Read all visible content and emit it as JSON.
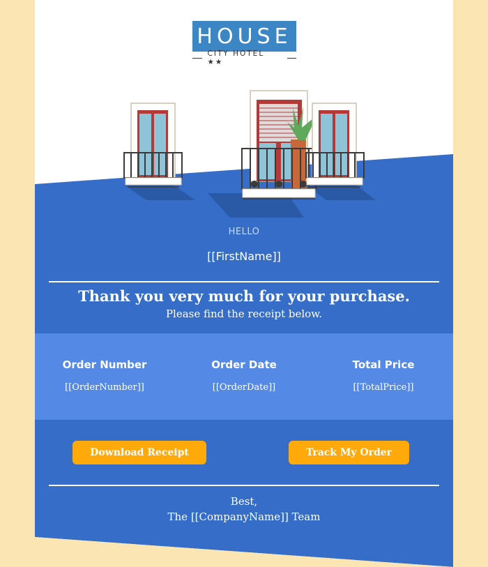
{
  "brand": {
    "name": "HOUSE",
    "tagline": "CITY HOTEL ★★"
  },
  "greeting": {
    "hello": "HELLO",
    "first_name": "[[FirstName]]"
  },
  "message": {
    "thanks": "Thank you very much for your purchase.",
    "subtitle": "Please find the receipt below."
  },
  "order": [
    {
      "label": "Order Number",
      "value": "[[OrderNumber]]"
    },
    {
      "label": "Order Date",
      "value": "[[OrderDate]]"
    },
    {
      "label": "Total Price",
      "value": "[[TotalPrice]]"
    }
  ],
  "actions": {
    "download": "Download Receipt",
    "track": "Track My Order"
  },
  "signoff": {
    "best": "Best,",
    "team": "The [[CompanyName]] Team"
  },
  "colors": {
    "page_bg": "#fbe5b3",
    "primary_blue": "#356dc9",
    "details_blue": "#548ae6",
    "button_orange": "#ffa90a",
    "logo_blue": "#3d86c6"
  }
}
